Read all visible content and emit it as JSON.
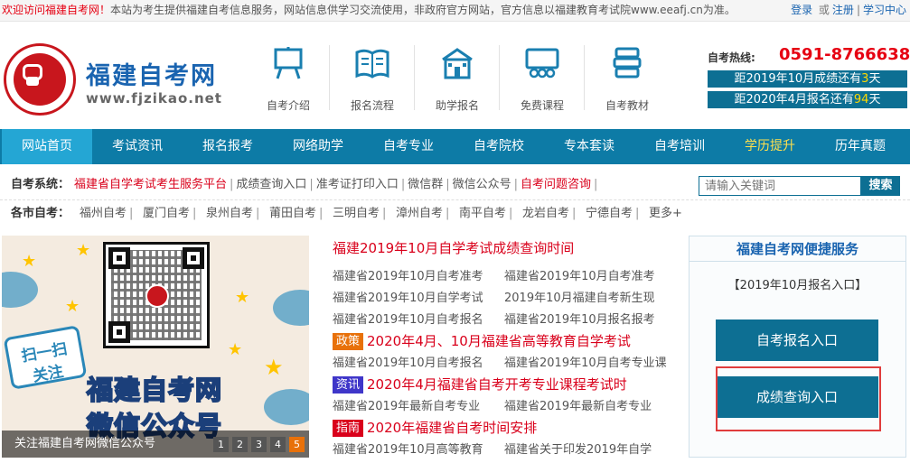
{
  "topbar": {
    "welcome": "欢迎访问福建自考网！",
    "notice": "本站为考生提供福建自考信息服务，网站信息供学习交流使用，非政府官方网站，官方信息以福建教育考试院www.eeafj.cn为准。",
    "login": "登录",
    "or": "或",
    "register": "注册",
    "sep": "|",
    "study": "学习中心"
  },
  "header": {
    "site_name": "福建自考网",
    "site_url": "www.fjzikao.net",
    "quick_links": [
      {
        "label": "自考介绍",
        "icon": "easel-icon"
      },
      {
        "label": "报名流程",
        "icon": "book-icon"
      },
      {
        "label": "助学报名",
        "icon": "school-icon"
      },
      {
        "label": "免费课程",
        "icon": "classroom-icon"
      },
      {
        "label": "自考教材",
        "icon": "books-stack-icon"
      }
    ],
    "hotline_label": "自考热线:",
    "hotline": "0591-87666380",
    "countdown1": {
      "pre": "距2019年10月成绩还有",
      "num": "3",
      "post": "天"
    },
    "countdown2": {
      "pre": "距2020年4月报名还有",
      "num": "94",
      "post": "天"
    }
  },
  "nav": [
    "网站首页",
    "考试资讯",
    "报名报考",
    "网络助学",
    "自考专业",
    "自考院校",
    "专本套读",
    "自考培训",
    "学历提升",
    "历年真题"
  ],
  "system_row": {
    "label": "自考系统：",
    "items": [
      "福建省自学考试考生服务平台",
      "成绩查询入口",
      "准考证打印入口",
      "微信群",
      "微信公众号",
      "自考问题咨询"
    ]
  },
  "city_row": {
    "label": "各市自考：",
    "items": [
      "福州自考",
      "厦门自考",
      "泉州自考",
      "莆田自考",
      "三明自考",
      "漳州自考",
      "南平自考",
      "龙岩自考",
      "宁德自考",
      "更多+"
    ]
  },
  "search": {
    "placeholder": "请输入关键词",
    "button": "搜索"
  },
  "banner": {
    "scan_line1": "扫一扫",
    "scan_line2": "关注",
    "title": "福建自考网",
    "subtitle": "微信公众号",
    "caption": "关注福建自考网微信公众号",
    "pages": [
      "1",
      "2",
      "3",
      "4",
      "5"
    ],
    "active_page": "5"
  },
  "news": {
    "headline": "福建2019年10月自学考试成绩查询时间",
    "rows": [
      [
        "福建省2019年10月自考准考",
        "福建省2019年10月自考准考"
      ],
      [
        "福建省2019年10月自学考试",
        "2019年10月福建自考新生现"
      ],
      [
        "福建省2019年10月自考报名",
        "福建省2019年10月报名报考"
      ]
    ],
    "tag1": "政策",
    "hl1": "2020年4月、10月福建省高等教育自学考试",
    "rows2": [
      [
        "福建省2019年10月自考报名",
        "福建省2019年10月自考专业课"
      ]
    ],
    "tag2": "资讯",
    "hl2": "2020年4月福建省自考开考专业课程考试时",
    "rows3": [
      [
        "福建省2019年最新自考专业",
        "福建省2019年最新自考专业"
      ]
    ],
    "tag3": "指南",
    "hl3": "2020年福建省自考时间安排",
    "rows4": [
      [
        "福建省2019年10月高等教育",
        "福建省关于印发2019年自学"
      ]
    ]
  },
  "side": {
    "title": "福建自考网便捷服务",
    "link": "【2019年10月报名入口】",
    "btn1": "自考报名入口",
    "btn2": "成绩查询入口"
  },
  "colors": {
    "nav": "#0d7ba6",
    "accent": "#d9001b",
    "button": "#0d6f93"
  }
}
